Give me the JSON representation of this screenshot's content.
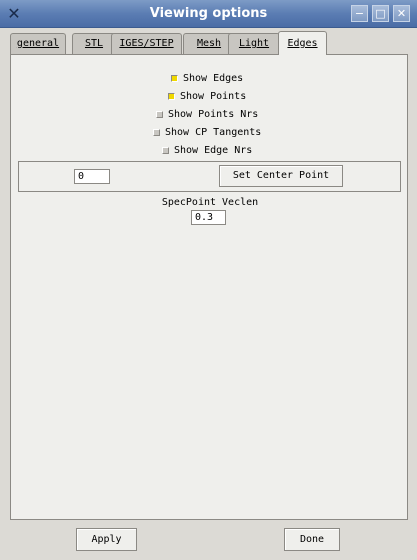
{
  "window": {
    "title": "Viewing options",
    "icon": "x-app-icon",
    "buttons": [
      "minimize",
      "maximize",
      "close"
    ]
  },
  "tabs": [
    {
      "label": "general",
      "active": false
    },
    {
      "label": "STL",
      "active": false
    },
    {
      "label": "IGES/STEP",
      "active": false
    },
    {
      "label": "Mesh",
      "active": false
    },
    {
      "label": "Light",
      "active": false
    },
    {
      "label": "Edges",
      "active": true
    }
  ],
  "edges": {
    "checkboxes": [
      {
        "label": "Show Edges",
        "checked": true
      },
      {
        "label": "Show Points",
        "checked": true
      },
      {
        "label": "Show Points Nrs",
        "checked": false
      },
      {
        "label": "Show CP Tangents",
        "checked": false
      },
      {
        "label": "Show Edge Nrs",
        "checked": false
      }
    ],
    "center_point_value": "0",
    "set_center_label": "Set Center Point",
    "specpoint_label": "SpecPoint Veclen",
    "specpoint_value": "0.3"
  },
  "footer": {
    "apply_label": "Apply",
    "done_label": "Done"
  },
  "colors": {
    "title_bar": "#5b7db3",
    "window_bg": "#dcdad5",
    "panel_bg": "#efefec",
    "checkbox_on": "#f0d800"
  }
}
